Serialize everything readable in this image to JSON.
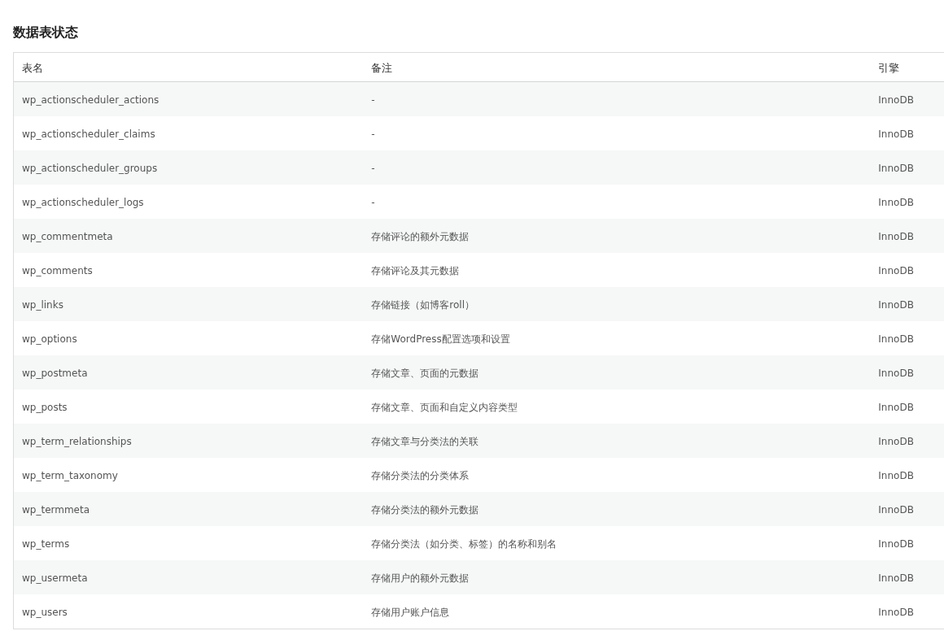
{
  "title": "数据表状态",
  "table": {
    "columns": [
      "表名",
      "备注",
      "引擎"
    ],
    "rows": [
      [
        "wp_actionscheduler_actions",
        "-",
        "InnoDB"
      ],
      [
        "wp_actionscheduler_claims",
        "-",
        "InnoDB"
      ],
      [
        "wp_actionscheduler_groups",
        "-",
        "InnoDB"
      ],
      [
        "wp_actionscheduler_logs",
        "-",
        "InnoDB"
      ],
      [
        "wp_commentmeta",
        "存储评论的额外元数据",
        "InnoDB"
      ],
      [
        "wp_comments",
        "存储评论及其元数据",
        "InnoDB"
      ],
      [
        "wp_links",
        "存储链接（如博客roll）",
        "InnoDB"
      ],
      [
        "wp_options",
        "存储WordPress配置选项和设置",
        "InnoDB"
      ],
      [
        "wp_postmeta",
        "存储文章、页面的元数据",
        "InnoDB"
      ],
      [
        "wp_posts",
        "存储文章、页面和自定义内容类型",
        "InnoDB"
      ],
      [
        "wp_term_relationships",
        "存储文章与分类法的关联",
        "InnoDB"
      ],
      [
        "wp_term_taxonomy",
        "存储分类法的分类体系",
        "InnoDB"
      ],
      [
        "wp_termmeta",
        "存储分类法的额外元数据",
        "InnoDB"
      ],
      [
        "wp_terms",
        "存储分类法（如分类、标签）的名称和别名",
        "InnoDB"
      ],
      [
        "wp_usermeta",
        "存储用户的额外元数据",
        "InnoDB"
      ],
      [
        "wp_users",
        "存储用户账户信息",
        "InnoDB"
      ]
    ]
  }
}
